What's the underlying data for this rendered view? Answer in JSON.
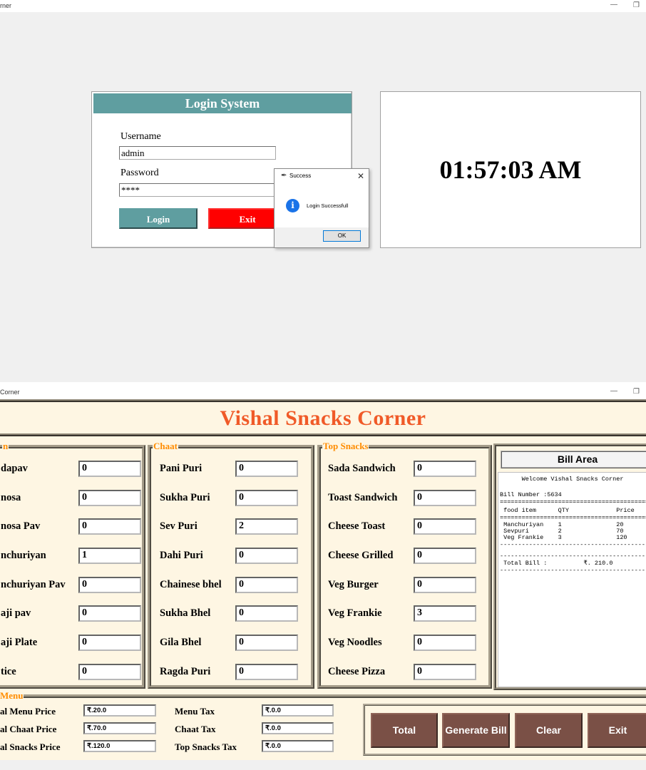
{
  "login_window": {
    "title": "rner",
    "panel_title": "Login System",
    "username_label": "Username",
    "username_value": "admin",
    "password_label": "Password",
    "password_value": "****",
    "login_button": "Login",
    "exit_button": "Exit",
    "clock": "01:57:03 AM",
    "dialog": {
      "title": "Success",
      "message": "Login Successfull",
      "ok_button": "OK"
    }
  },
  "app_window": {
    "title": "Corner",
    "heading": "Vishal Snacks Corner",
    "groups": {
      "menu": {
        "title": "n",
        "items": [
          {
            "label": "dapav",
            "qty": "0"
          },
          {
            "label": "nosa",
            "qty": "0"
          },
          {
            "label": "nosa Pav",
            "qty": "0"
          },
          {
            "label": "nchuriyan",
            "qty": "1"
          },
          {
            "label": "nchuriyan Pav",
            "qty": "0"
          },
          {
            "label": "aji pav",
            "qty": "0"
          },
          {
            "label": "aji Plate",
            "qty": "0"
          },
          {
            "label": "tice",
            "qty": "0"
          }
        ]
      },
      "chaat": {
        "title": "Chaat",
        "items": [
          {
            "label": "Pani Puri",
            "qty": "0"
          },
          {
            "label": "Sukha Puri",
            "qty": "0"
          },
          {
            "label": "Sev Puri",
            "qty": "2"
          },
          {
            "label": "Dahi Puri",
            "qty": "0"
          },
          {
            "label": "Chainese bhel",
            "qty": "0"
          },
          {
            "label": "Sukha Bhel",
            "qty": "0"
          },
          {
            "label": "Gila Bhel",
            "qty": "0"
          },
          {
            "label": "Ragda Puri",
            "qty": "0"
          }
        ]
      },
      "top_snacks": {
        "title": "Top Snacks",
        "items": [
          {
            "label": "Sada Sandwich",
            "qty": "0"
          },
          {
            "label": "Toast Sandwich",
            "qty": "0"
          },
          {
            "label": "Cheese Toast",
            "qty": "0"
          },
          {
            "label": "Cheese Grilled",
            "qty": "0"
          },
          {
            "label": "Veg Burger",
            "qty": "0"
          },
          {
            "label": "Veg Frankie",
            "qty": "3"
          },
          {
            "label": "Veg Noodles",
            "qty": "0"
          },
          {
            "label": "Cheese Pizza",
            "qty": "0"
          }
        ]
      }
    },
    "bill": {
      "title": "Bill Area",
      "lines": [
        "      Welcome Vishal Snacks Corner",
        "",
        "Bill Number :5634",
        "=========================================",
        " food item      QTY             Price",
        "=========================================",
        " Manchuriyan    1               20",
        " Sevpuri        2               70",
        " Veg Frankie    3               120",
        "-----------------------------------------",
        "",
        "-----------------------------------------",
        " Total Bill :          ₹. 210.0",
        "-----------------------------------------"
      ]
    },
    "summary": {
      "title": "Menu",
      "total_menu_label": "al Menu Price",
      "total_menu_value": "₹.20.0",
      "total_chaat_label": "al Chaat Price",
      "total_chaat_value": "₹.70.0",
      "total_snacks_label": "al Snacks Price",
      "total_snacks_value": "₹.120.0",
      "menu_tax_label": "Menu Tax",
      "menu_tax_value": "₹.0.0",
      "chaat_tax_label": "Chaat Tax",
      "chaat_tax_value": "₹.0.0",
      "top_snacks_tax_label": "Top Snacks Tax",
      "top_snacks_tax_value": "₹.0.0"
    },
    "buttons": {
      "total": "Total",
      "generate_bill": "Generate Bill",
      "clear": "Clear",
      "exit": "Exit"
    },
    "colors": {
      "heading": "#f05a28",
      "group_title": "#ff8c00",
      "background": "#fef6e3",
      "action_button": "#7a5046",
      "login_header": "#5f9ea0",
      "exit_button": "#ff0000"
    }
  }
}
